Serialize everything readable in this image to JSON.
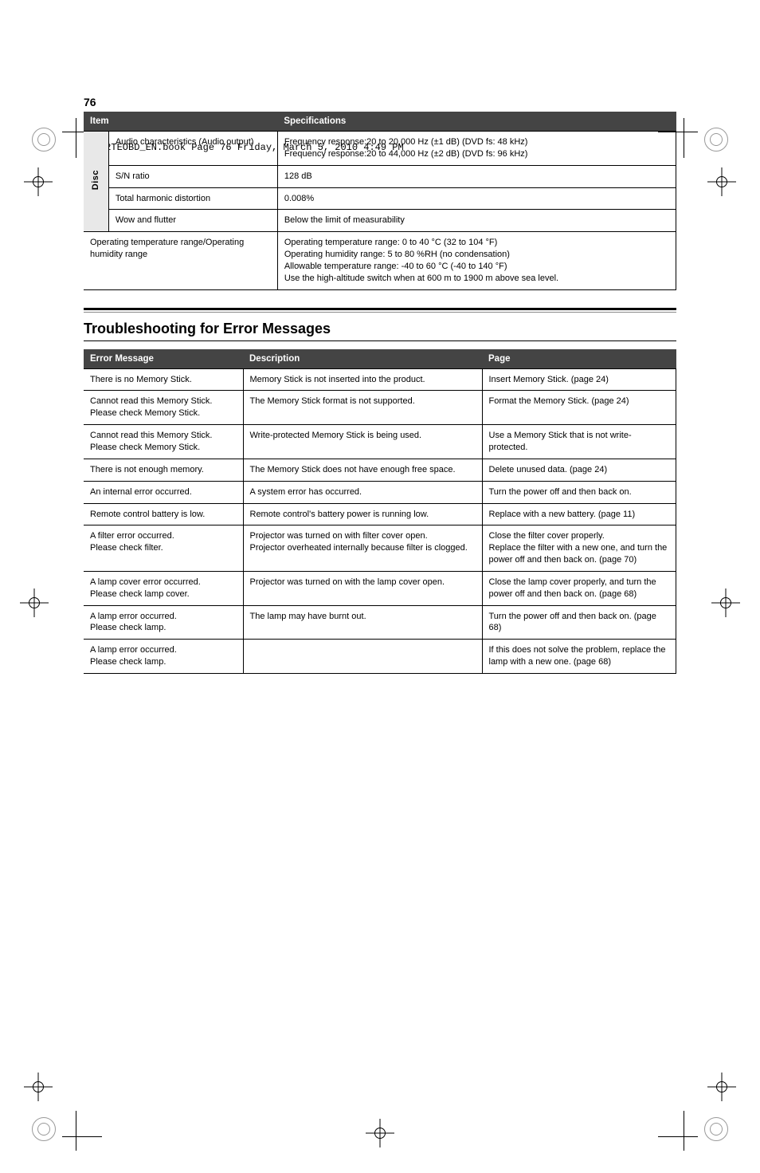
{
  "header_line": "E2TEOBD_EN.book  Page 76  Friday, March 5, 2010  4:49 PM",
  "page_num_top": "76",
  "table1": {
    "headers": [
      "Item",
      "Specifications"
    ],
    "group_label": "Disc",
    "rows": [
      {
        "label": "Audio characteristics (Audio output)",
        "spec": "Frequency response:20 to 20,000 Hz (±1 dB) (DVD fs: 48 kHz)\nFrequency response:20 to 44,000 Hz (±2 dB) (DVD fs: 96 kHz)"
      },
      {
        "label": "S/N ratio",
        "spec": "128 dB"
      },
      {
        "label": "Total harmonic distortion",
        "spec": "0.008%"
      },
      {
        "label": "Wow and flutter",
        "spec": "Below the limit of measurability"
      }
    ],
    "footer_row": {
      "label": "Operating temperature range/Operating humidity range",
      "spec": "Operating temperature range: 0 to 40 °C (32 to 104 °F)\nOperating humidity range: 5 to 80 %RH (no condensation)\nAllowable temperature range: -40 to 60 °C (-40 to 140 °F)\nUse the high-altitude switch when at 600 m to 1900 m above sea level."
    }
  },
  "section_title": "Troubleshooting for Error Messages",
  "table2": {
    "headers": [
      "Error Message",
      "Description",
      "Page"
    ],
    "rows": [
      {
        "msg": "There is no Memory Stick.",
        "desc": "Memory Stick is not inserted into the product.",
        "page": "Insert Memory Stick. (page 24)"
      },
      {
        "msg": "Cannot read this Memory Stick.\nPlease check Memory Stick.",
        "desc": "The Memory Stick format is not supported.",
        "page": "Format the Memory Stick. (page 24)"
      },
      {
        "msg": "Cannot read this Memory Stick.\nPlease check Memory Stick.",
        "desc": "Write-protected Memory Stick is being used.",
        "page": "Use a Memory Stick that is not write-protected."
      },
      {
        "msg": "There is not enough memory.",
        "desc": "The Memory Stick does not have enough free space.",
        "page": "Delete unused data. (page 24)"
      },
      {
        "msg": "An internal error occurred.",
        "desc": "A system error has occurred.",
        "page": "Turn the power off and then back on."
      },
      {
        "msg": "Remote control battery is low.",
        "desc": "Remote control's battery power is running low.",
        "page": "Replace with a new battery. (page 11)"
      },
      {
        "msg": "A filter error occurred.\nPlease check filter.",
        "desc": "Projector was turned on with filter cover open.\nProjector overheated internally because filter is clogged.",
        "page": "Close the filter cover properly.\nReplace the filter with a new one, and turn the power off and then back on. (page 70)"
      },
      {
        "msg": "A lamp cover error occurred.\nPlease check lamp cover.",
        "desc": "Projector was turned on with the lamp cover open.",
        "page": "Close the lamp cover properly, and turn the power off and then back on. (page 68)"
      },
      {
        "msg": "A lamp error occurred.\nPlease check lamp.",
        "desc": "The lamp may have burnt out.",
        "page": "Turn the power off and then back on. (page 68)"
      },
      {
        "msg": "A lamp error occurred.\nPlease check lamp.",
        "desc": "",
        "page": "If this does not solve the problem, replace the lamp with a new one. (page 68)"
      }
    ]
  },
  "bottom_meta": "",
  "corner_page": ""
}
